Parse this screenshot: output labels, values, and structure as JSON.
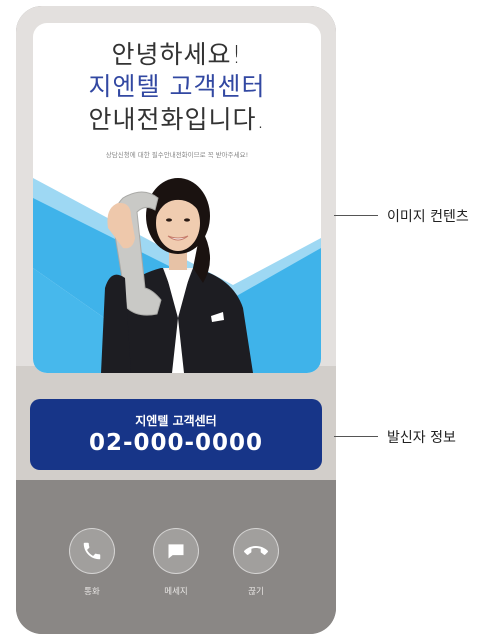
{
  "image": {
    "line1": "안녕하세요!",
    "line2": "지엔텔 고객센터",
    "line3": "안내전화입니다.",
    "subtext": "상담신청에 대한 필수안내전화이므로 꼭 받아주세요!"
  },
  "caller": {
    "name": "지엔텔 고객센터",
    "number": "02-000-0000"
  },
  "actions": {
    "call": "통화",
    "message": "메세지",
    "end": "끊기"
  },
  "callouts": {
    "image": "이미지 컨텐츠",
    "caller": "발신자 정보"
  },
  "colors": {
    "accent_blue": "#173588",
    "headline_blue": "#3248a2",
    "sky_blue": "#3fb3ea"
  }
}
